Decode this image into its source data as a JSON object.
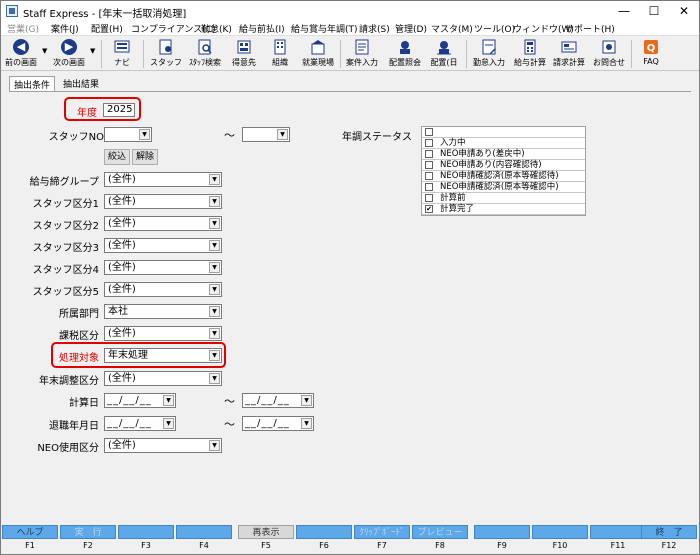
{
  "window": {
    "title": "Staff Express - [年末一括取消処理]",
    "minimize": "—",
    "maximize": "☐",
    "close": "✕"
  },
  "menu": [
    {
      "label": "営業(G)",
      "disabled": true
    },
    {
      "label": "案件(J)"
    },
    {
      "label": "配置(H)"
    },
    {
      "label": "コンプライアンス(C)"
    },
    {
      "label": "勤怠(K)"
    },
    {
      "label": "給与前払(I)"
    },
    {
      "label": "給与賞与年調(T)"
    },
    {
      "label": "請求(S)"
    },
    {
      "label": "管理(D)"
    },
    {
      "label": "マスタ(M)"
    },
    {
      "label": "ツール(O)"
    },
    {
      "label": "ウィンドウ(W)"
    },
    {
      "label": "サポート(H)"
    }
  ],
  "toolbar": {
    "back": "前の画面",
    "forward": "次の画面",
    "navi": "ナビ",
    "staff": "スタッフ",
    "staff_search": "ｽﾀｯﾌ検索",
    "client": "得意先",
    "org": "組織",
    "site": "就業現場",
    "case_input": "案件入力",
    "assign_view": "配置照会",
    "assign_day": "配置(日",
    "attendance": "勤怠入力",
    "payroll": "給与計算",
    "billing": "請求計算",
    "contact": "お問合せ",
    "faq": "FAQ"
  },
  "tabs": [
    "抽出条件",
    "抽出結果"
  ],
  "form": {
    "year_label": "年度",
    "year_value": "2025",
    "staff_no_label": "スタッフNO",
    "staff_no_from": "",
    "staff_no_to": "",
    "tilde": "～",
    "filter_button": "絞込",
    "clear_button": "解除",
    "pay_group_label": "給与締グループ",
    "pay_group_value": "(全件)",
    "staff_cat1_label": "スタッフ区分1",
    "staff_cat1_value": "(全件)",
    "staff_cat2_label": "スタッフ区分2",
    "staff_cat2_value": "(全件)",
    "staff_cat3_label": "スタッフ区分3",
    "staff_cat3_value": "(全件)",
    "staff_cat4_label": "スタッフ区分4",
    "staff_cat4_value": "(全件)",
    "staff_cat5_label": "スタッフ区分5",
    "staff_cat5_value": "(全件)",
    "department_label": "所属部門",
    "department_value": "本社",
    "tax_label": "課税区分",
    "tax_value": "(全件)",
    "target_label": "処理対象",
    "target_value": "年末処理",
    "yearend_adj_label": "年末調整区分",
    "yearend_adj_value": "(全件)",
    "calc_date_label": "計算日",
    "calc_date_from": "__/__/__",
    "calc_date_to": "__/__/__",
    "retire_date_label": "退職年月日",
    "retire_date_from": "__/__/__",
    "retire_date_to": "__/__/__",
    "neo_label": "NEO使用区分",
    "neo_value": "(全件)"
  },
  "status": {
    "label": "年調ステータス",
    "items": [
      {
        "text": "",
        "checked": false
      },
      {
        "text": "入力中",
        "checked": false
      },
      {
        "text": "NEO申請あり(差戻中)",
        "checked": false
      },
      {
        "text": "NEO申請あり(内容確認待)",
        "checked": false
      },
      {
        "text": "NEO申請確認済(原本等確認待)",
        "checked": false
      },
      {
        "text": "NEO申請確認済(原本等確認中)",
        "checked": false
      },
      {
        "text": "計算前",
        "checked": false
      },
      {
        "text": "計算完了",
        "checked": true
      }
    ]
  },
  "fkeys": [
    {
      "key": "F1",
      "label": "ヘルプ"
    },
    {
      "key": "F2",
      "label": "実　行",
      "disabled": true
    },
    {
      "key": "F3",
      "label": ""
    },
    {
      "key": "F4",
      "label": ""
    },
    {
      "key": "F5",
      "label": "再表示",
      "grey": true
    },
    {
      "key": "F6",
      "label": ""
    },
    {
      "key": "F7",
      "label": "ｸﾘｯﾌﾟﾎﾞｰﾄﾞ",
      "disabled": true
    },
    {
      "key": "F8",
      "label": "プレビュー",
      "disabled": true
    },
    {
      "key": "F9",
      "label": ""
    },
    {
      "key": "F10",
      "label": ""
    },
    {
      "key": "F11",
      "label": ""
    },
    {
      "key": "F12",
      "label": "終　了"
    }
  ]
}
